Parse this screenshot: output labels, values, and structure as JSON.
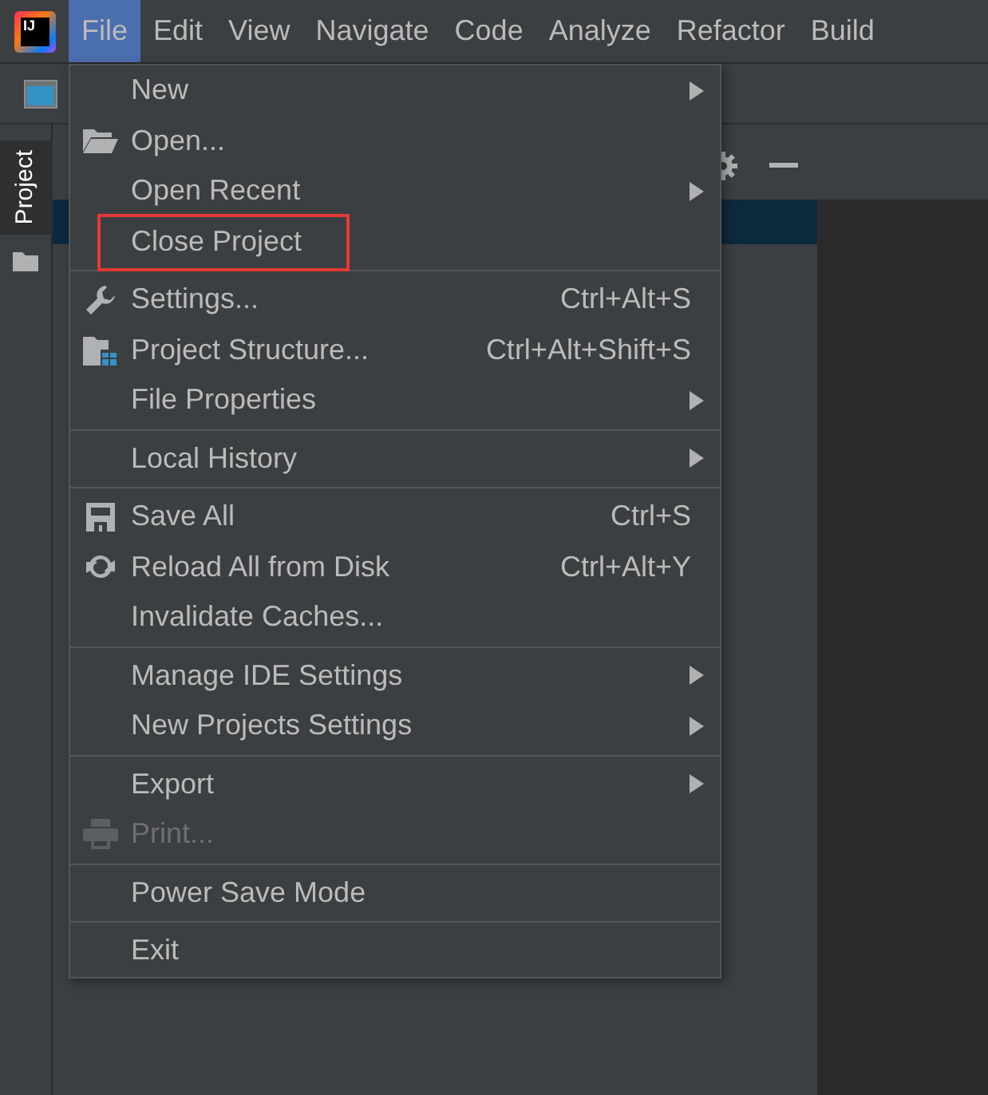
{
  "logo": {
    "text": "IJ"
  },
  "menubar": [
    {
      "label": "File",
      "selected": true
    },
    {
      "label": "Edit",
      "selected": false
    },
    {
      "label": "View",
      "selected": false
    },
    {
      "label": "Navigate",
      "selected": false
    },
    {
      "label": "Code",
      "selected": false
    },
    {
      "label": "Analyze",
      "selected": false
    },
    {
      "label": "Refactor",
      "selected": false
    },
    {
      "label": "Build",
      "selected": false
    }
  ],
  "side_tab": {
    "label": "Project"
  },
  "file_menu": [
    [
      {
        "label": "New",
        "submenu": true,
        "disabled": false,
        "highlighted": false
      },
      {
        "label": "Open...",
        "submenu": false,
        "disabled": false,
        "highlighted": false
      },
      {
        "label": "Open Recent",
        "submenu": true,
        "disabled": false,
        "highlighted": false
      },
      {
        "label": "Close Project",
        "submenu": false,
        "disabled": false,
        "highlighted": true
      }
    ],
    [
      {
        "label": "Settings...",
        "shortcut": "Ctrl+Alt+S",
        "submenu": false,
        "disabled": false,
        "highlighted": false
      },
      {
        "label": "Project Structure...",
        "shortcut": "Ctrl+Alt+Shift+S",
        "submenu": false,
        "disabled": false,
        "highlighted": false
      },
      {
        "label": "File Properties",
        "submenu": true,
        "disabled": false,
        "highlighted": false
      }
    ],
    [
      {
        "label": "Local History",
        "submenu": true,
        "disabled": false,
        "highlighted": false
      }
    ],
    [
      {
        "label": "Save All",
        "shortcut": "Ctrl+S",
        "submenu": false,
        "disabled": false,
        "highlighted": false
      },
      {
        "label": "Reload All from Disk",
        "shortcut": "Ctrl+Alt+Y",
        "submenu": false,
        "disabled": false,
        "highlighted": false
      },
      {
        "label": "Invalidate Caches...",
        "submenu": false,
        "disabled": false,
        "highlighted": false
      }
    ],
    [
      {
        "label": "Manage IDE Settings",
        "submenu": true,
        "disabled": false,
        "highlighted": false
      },
      {
        "label": "New Projects Settings",
        "submenu": true,
        "disabled": false,
        "highlighted": false
      }
    ],
    [
      {
        "label": "Export",
        "submenu": true,
        "disabled": false,
        "highlighted": false
      },
      {
        "label": "Print...",
        "submenu": false,
        "disabled": true,
        "highlighted": false
      }
    ],
    [
      {
        "label": "Power Save Mode",
        "submenu": false,
        "disabled": false,
        "highlighted": false
      }
    ],
    [
      {
        "label": "Exit",
        "submenu": false,
        "disabled": false,
        "highlighted": false
      }
    ]
  ]
}
